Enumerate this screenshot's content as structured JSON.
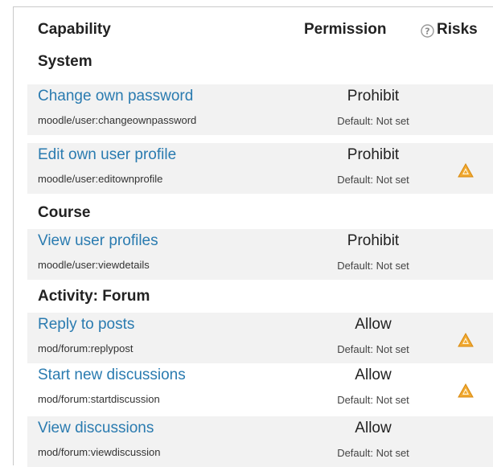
{
  "header": {
    "capability": "Capability",
    "permission": "Permission",
    "risks": "Risks",
    "help_icon": "question-circle-icon"
  },
  "sections": [
    {
      "title": "System"
    },
    {
      "title": "Course"
    },
    {
      "title": "Activity: Forum"
    }
  ],
  "rows": [
    {
      "label": "Change own password",
      "capability": "moodle/user:changeownpassword",
      "permission": "Prohibit",
      "default": "Default: Not set",
      "risk": false
    },
    {
      "label": "Edit own user profile",
      "capability": "moodle/user:editownprofile",
      "permission": "Prohibit",
      "default": "Default: Not set",
      "risk": true
    },
    {
      "label": "View user profiles",
      "capability": "moodle/user:viewdetails",
      "permission": "Prohibit",
      "default": "Default: Not set",
      "risk": false
    },
    {
      "label": "Reply to posts",
      "capability": "mod/forum:replypost",
      "permission": "Allow",
      "default": "Default: Not set",
      "risk": true
    },
    {
      "label": "Start new discussions",
      "capability": "mod/forum:startdiscussion",
      "permission": "Allow",
      "default": "Default: Not set",
      "risk": true
    },
    {
      "label": "View discussions",
      "capability": "mod/forum:viewdiscussion",
      "permission": "Allow",
      "default": "Default: Not set",
      "risk": false
    }
  ],
  "colors": {
    "link": "#2a7bb0",
    "row_shade": "#f2f2f2",
    "risk_icon": "#f0a830"
  }
}
